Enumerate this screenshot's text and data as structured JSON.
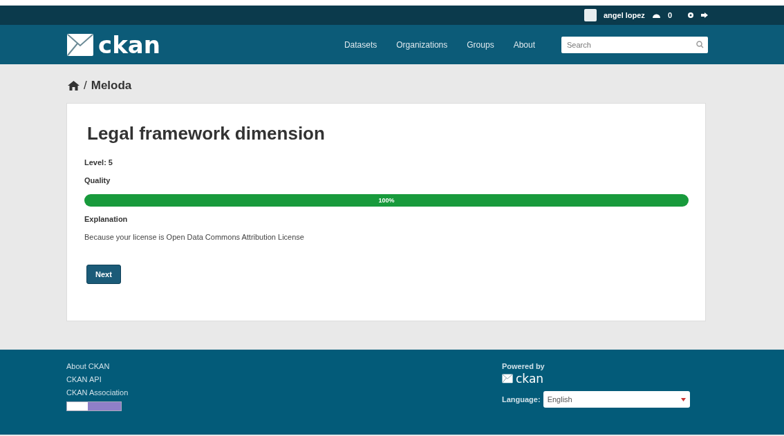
{
  "account": {
    "user": "angel lopez",
    "count": "0"
  },
  "nav": {
    "items": [
      "Datasets",
      "Organizations",
      "Groups",
      "About"
    ],
    "search": {
      "placeholder": "Search"
    },
    "logo": "ckan"
  },
  "breadcrumb": {
    "separator": "/",
    "items": [
      "Meloda"
    ]
  },
  "content": {
    "title": "Legal framework dimension",
    "level_label": "Level: 5",
    "quality_label": "Quality",
    "quality": {
      "level": 1,
      "reading": "100%"
    },
    "explanation_label": "Explanation",
    "explanation": "Because your license is Open Data Commons Attribution License",
    "button": "Next"
  },
  "footer": {
    "links": [
      "About CKAN",
      "CKAN API",
      "CKAN Association"
    ],
    "powered_by": "Powered by",
    "logo": "ckan",
    "language_label": "Language:",
    "language": "English"
  }
}
